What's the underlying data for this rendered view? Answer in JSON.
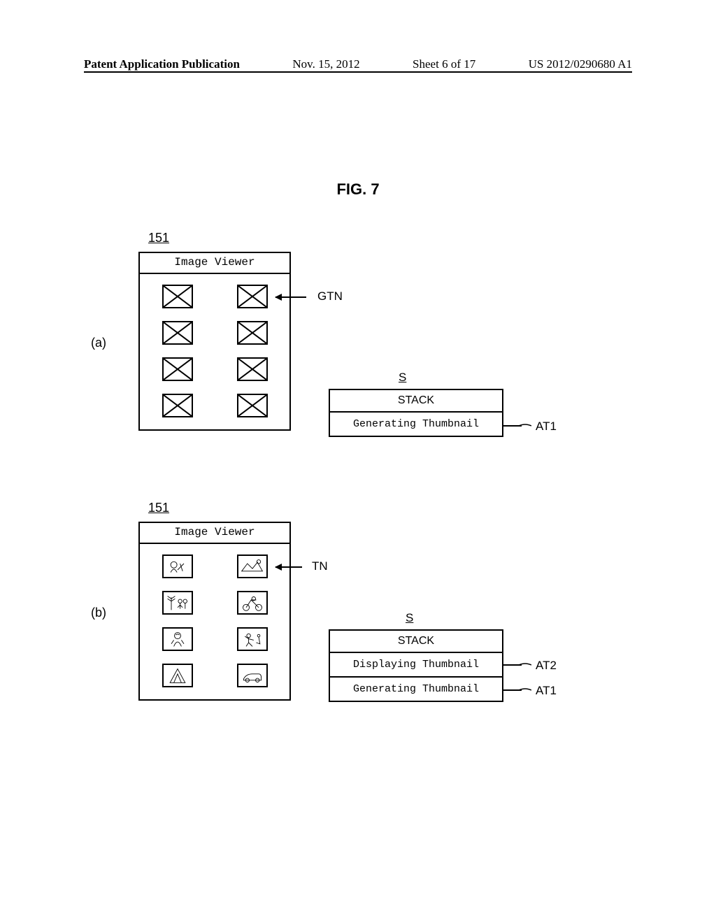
{
  "header": {
    "left": "Patent Application Publication",
    "date": "Nov. 15, 2012",
    "sheet": "Sheet 6 of 17",
    "pubnum": "US 2012/0290680 A1"
  },
  "figure_title": "FIG. 7",
  "panels": {
    "a": {
      "label": "(a)",
      "refnum": "151",
      "viewer_title": "Image Viewer",
      "callout_gtn": "GTN",
      "stack": {
        "ref": "S",
        "header": "STACK",
        "rows": [
          "Generating Thumbnail"
        ],
        "row_labels": [
          "AT1"
        ]
      }
    },
    "b": {
      "label": "(b)",
      "refnum": "151",
      "viewer_title": "Image Viewer",
      "callout_tn": "TN",
      "stack": {
        "ref": "S",
        "header": "STACK",
        "rows": [
          "Displaying Thumbnail",
          "Generating Thumbnail"
        ],
        "row_labels": [
          "AT2",
          "AT1"
        ]
      }
    }
  }
}
